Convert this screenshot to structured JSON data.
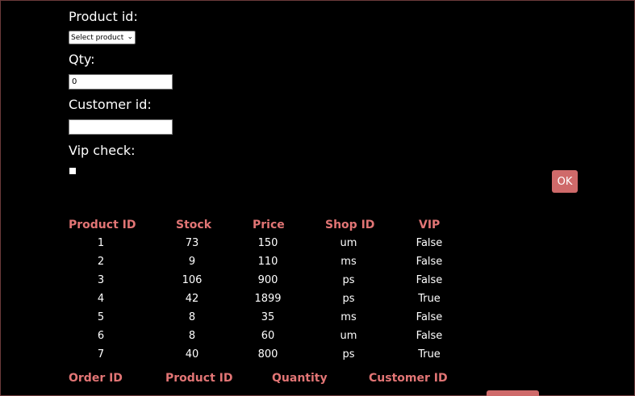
{
  "form": {
    "product_id_label": "Product id:",
    "product_select_value": "Select product",
    "qty_label": "Qty:",
    "qty_value": "0",
    "customer_id_label": "Customer id:",
    "customer_id_value": "",
    "vip_label": "Vip check:",
    "ok_label": "OK"
  },
  "products_table": {
    "headers": [
      "Product ID",
      "Stock",
      "Price",
      "Shop ID",
      "VIP"
    ],
    "rows": [
      [
        "1",
        "73",
        "150",
        "um",
        "False"
      ],
      [
        "2",
        "9",
        "110",
        "ms",
        "False"
      ],
      [
        "3",
        "106",
        "900",
        "ps",
        "False"
      ],
      [
        "4",
        "42",
        "1899",
        "ps",
        "True"
      ],
      [
        "5",
        "8",
        "35",
        "ms",
        "False"
      ],
      [
        "6",
        "8",
        "60",
        "um",
        "False"
      ],
      [
        "7",
        "40",
        "800",
        "ps",
        "True"
      ]
    ]
  },
  "orders_table": {
    "headers": [
      "Order ID",
      "Product ID",
      "Quantity",
      "Customer ID"
    ]
  },
  "colors": {
    "background": "#000000",
    "header_text": "#e27575",
    "button": "#cf6a6a"
  }
}
